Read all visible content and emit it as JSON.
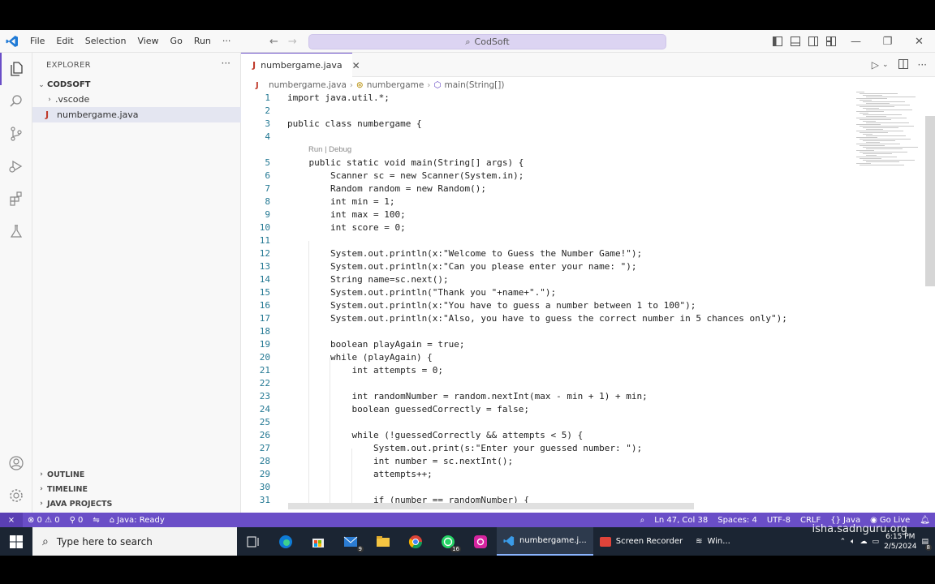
{
  "titlebar": {
    "menu": [
      "File",
      "Edit",
      "Selection",
      "View",
      "Go",
      "Run",
      "···"
    ],
    "command_center": "CodSoft"
  },
  "sidebar": {
    "title": "EXPLORER",
    "more": "···",
    "root": "CODSOFT",
    "items": [
      ".vscode",
      "numbergame.java"
    ],
    "sections": [
      "OUTLINE",
      "TIMELINE",
      "JAVA PROJECTS"
    ]
  },
  "editor": {
    "tab": "numbergame.java",
    "breadcrumb": [
      "numbergame.java",
      "numbergame",
      "main(String[])"
    ],
    "codelens": "Run | Debug",
    "lines": [
      {
        "n": "1",
        "t": "import java.util.*;"
      },
      {
        "n": "2",
        "t": ""
      },
      {
        "n": "3",
        "t": "public class numbergame {"
      },
      {
        "n": "4",
        "t": ""
      },
      {
        "n": "5",
        "t": "    public static void main(String[] args) {"
      },
      {
        "n": "6",
        "t": "        Scanner sc = new Scanner(System.in);"
      },
      {
        "n": "7",
        "t": "        Random random = new Random();"
      },
      {
        "n": "8",
        "t": "        int min = 1;"
      },
      {
        "n": "9",
        "t": "        int max = 100;"
      },
      {
        "n": "10",
        "t": "        int score = 0;"
      },
      {
        "n": "11",
        "t": ""
      },
      {
        "n": "12",
        "t": "        System.out.println(x:\"Welcome to Guess the Number Game!\");"
      },
      {
        "n": "13",
        "t": "        System.out.println(x:\"Can you please enter your name: \");"
      },
      {
        "n": "14",
        "t": "        String name=sc.next();"
      },
      {
        "n": "15",
        "t": "        System.out.println(\"Thank you \"+name+\".\");"
      },
      {
        "n": "16",
        "t": "        System.out.println(x:\"You have to guess a number between 1 to 100\");"
      },
      {
        "n": "17",
        "t": "        System.out.println(x:\"Also, you have to guess the correct number in 5 chances only\");"
      },
      {
        "n": "18",
        "t": ""
      },
      {
        "n": "19",
        "t": "        boolean playAgain = true;"
      },
      {
        "n": "20",
        "t": "        while (playAgain) {"
      },
      {
        "n": "21",
        "t": "            int attempts = 0;"
      },
      {
        "n": "22",
        "t": ""
      },
      {
        "n": "23",
        "t": "            int randomNumber = random.nextInt(max - min + 1) + min;"
      },
      {
        "n": "24",
        "t": "            boolean guessedCorrectly = false;"
      },
      {
        "n": "25",
        "t": ""
      },
      {
        "n": "26",
        "t": "            while (!guessedCorrectly && attempts < 5) {"
      },
      {
        "n": "27",
        "t": "                System.out.print(s:\"Enter your guessed number: \");"
      },
      {
        "n": "28",
        "t": "                int number = sc.nextInt();"
      },
      {
        "n": "29",
        "t": "                attempts++;"
      },
      {
        "n": "30",
        "t": ""
      },
      {
        "n": "31",
        "t": "                if (number == randomNumber) {"
      }
    ]
  },
  "statusbar": {
    "problems": "⊗ 0 ⚠ 0",
    "ports": "0",
    "java": "Java: Ready",
    "position": "Ln 47, Col 38",
    "spaces": "Spaces: 4",
    "encoding": "UTF-8",
    "eol": "CRLF",
    "language": "Java",
    "golive": "Go Live"
  },
  "taskbar": {
    "search_placeholder": "Type here to search",
    "apps": [
      "numbergame.j...",
      "Screen Recorder",
      "Win..."
    ],
    "time": "6:15 PM",
    "date": "2/5/2024",
    "mail_badge": "9",
    "whatsapp_badge": "16",
    "notif": "8"
  },
  "watermark": "isha.sadnguru.org",
  "colors": {
    "accent": "#6a4ec7",
    "statusbar": "#6a4ec7",
    "taskbar": "#1b2533"
  }
}
